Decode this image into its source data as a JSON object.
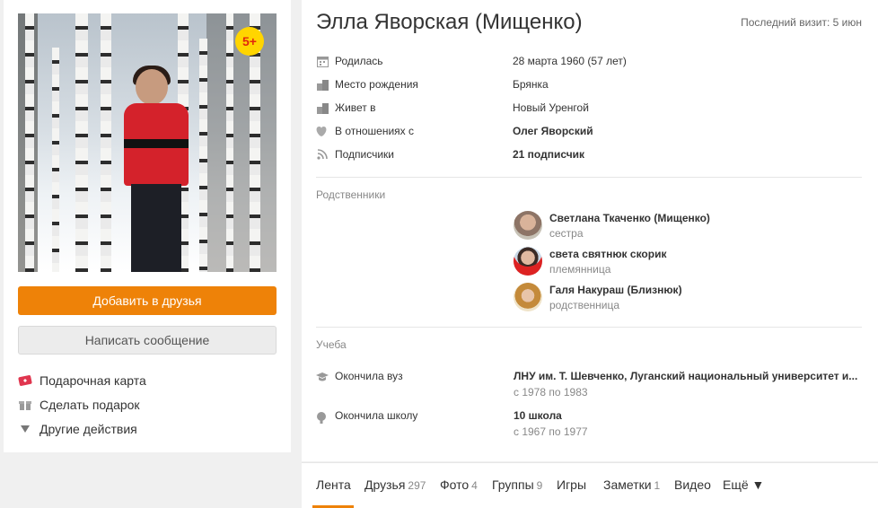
{
  "profile": {
    "name": "Элла Яворская (Мищенко)",
    "last_visit": "Последний визит: 5 июн",
    "photo_badge": "5+"
  },
  "actions": {
    "add_friend": "Добавить в друзья",
    "write_message": "Написать сообщение",
    "gift_card": "Подарочная карта",
    "make_gift": "Сделать подарок",
    "other_actions": "Другие действия"
  },
  "info": [
    {
      "icon": "calendar-icon",
      "label": "Родилась",
      "value": "28 марта 1960 (57 лет)",
      "bold": false
    },
    {
      "icon": "building-icon",
      "label": "Место рождения",
      "value": "Брянка",
      "bold": false
    },
    {
      "icon": "building-icon",
      "label": "Живет в",
      "value": "Новый Уренгой",
      "bold": false
    },
    {
      "icon": "hearts-icon",
      "label": "В отношениях с",
      "value": "Олег Яворский",
      "bold": true
    },
    {
      "icon": "rss-icon",
      "label": "Подписчики",
      "value": "21 подписчик",
      "bold": true
    }
  ],
  "relatives": {
    "title": "Родственники",
    "items": [
      {
        "name": "Светлана Ткаченко (Мищенко)",
        "role": "сестра"
      },
      {
        "name": "света святнюк скорик",
        "role": "племянница"
      },
      {
        "name": "Галя Накураш (Близнюк)",
        "role": "родственница"
      }
    ]
  },
  "education": {
    "title": "Учеба",
    "items": [
      {
        "icon": "graduation-cap-icon",
        "label": "Окончила вуз",
        "value": "ЛНУ им. Т. Шевченко, Луганский национальный университет и...",
        "years": "с 1978 по 1983"
      },
      {
        "icon": "school-bell-icon",
        "label": "Окончила школу",
        "value": "10 школа",
        "years": "с 1967 по 1977"
      }
    ]
  },
  "tabs": [
    {
      "label": "Лента",
      "count": ""
    },
    {
      "label": "Друзья",
      "count": "297"
    },
    {
      "label": "Фото",
      "count": "4"
    },
    {
      "label": "Группы",
      "count": "9"
    },
    {
      "label": "Игры",
      "count": ""
    },
    {
      "label": "Заметки",
      "count": "1"
    },
    {
      "label": "Видео",
      "count": ""
    },
    {
      "label": "Ещё ▼",
      "count": ""
    }
  ],
  "colors": {
    "accent": "#ee8208",
    "badge_bg": "#ffd500",
    "badge_text": "#e0260d"
  }
}
